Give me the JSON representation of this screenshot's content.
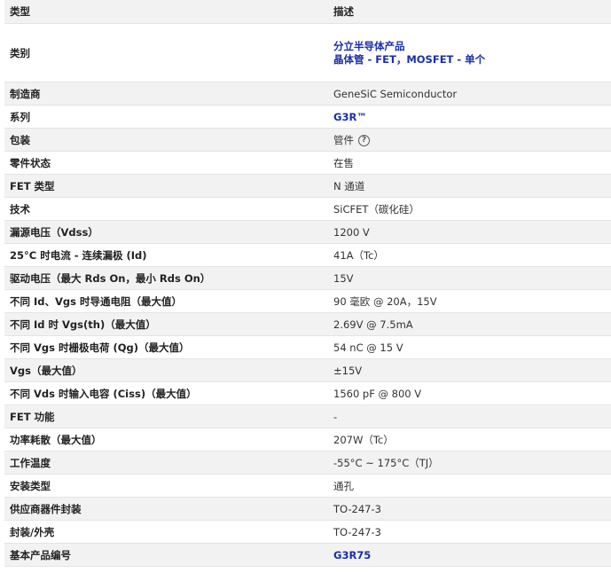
{
  "header": {
    "col_type": "类型",
    "col_desc": "描述"
  },
  "rows": [
    {
      "label": "类别",
      "value_lines": [
        "分立半导体产品",
        "晶体管 - FET，MOSFET - 单个"
      ],
      "link": true
    },
    {
      "label": "制造商",
      "value": "GeneSiC Semiconductor",
      "link": false
    },
    {
      "label": "系列",
      "value": "G3R™",
      "link": true
    },
    {
      "label": "包装",
      "value": "管件",
      "link": false,
      "help_icon": "help-circle-icon",
      "help_glyph": "?"
    },
    {
      "label": "零件状态",
      "value": "在售",
      "link": false
    },
    {
      "label": "FET 类型",
      "value": "N 通道",
      "link": false
    },
    {
      "label": "技术",
      "value": "SiCFET（碳化硅）",
      "link": false
    },
    {
      "label": "漏源电压（Vdss）",
      "value": "1200 V",
      "link": false
    },
    {
      "label": "25°C 时电流 - 连续漏极 (Id)",
      "value": "41A（Tc）",
      "link": false
    },
    {
      "label": "驱动电压（最大 Rds On，最小 Rds On）",
      "value": "15V",
      "link": false
    },
    {
      "label": "不同 Id、Vgs 时导通电阻（最大值）",
      "value": "90 毫欧 @ 20A，15V",
      "link": false
    },
    {
      "label": "不同 Id 时 Vgs(th)（最大值）",
      "value": "2.69V @ 7.5mA",
      "link": false
    },
    {
      "label": "不同 Vgs 时栅极电荷 (Qg)（最大值）",
      "value": "54 nC @ 15 V",
      "link": false
    },
    {
      "label": "Vgs（最大值）",
      "value": "±15V",
      "link": false
    },
    {
      "label": "不同 Vds 时输入电容 (Ciss)（最大值）",
      "value": "1560 pF @ 800 V",
      "link": false
    },
    {
      "label": "FET 功能",
      "value": "-",
      "link": false
    },
    {
      "label": "功率耗散（最大值）",
      "value": "207W（Tc）",
      "link": false
    },
    {
      "label": "工作温度",
      "value": "-55°C ~ 175°C（TJ）",
      "link": false
    },
    {
      "label": "安装类型",
      "value": "通孔",
      "link": false
    },
    {
      "label": "供应商器件封装",
      "value": "TO-247-3",
      "link": false
    },
    {
      "label": "封装/外壳",
      "value": "TO-247-3",
      "link": false
    },
    {
      "label": "基本产品编号",
      "value": "G3R75",
      "link": true
    }
  ],
  "colors": {
    "link": "#1a2ea8",
    "stripe": "#f2f2f2",
    "border": "#e4e4e4"
  }
}
